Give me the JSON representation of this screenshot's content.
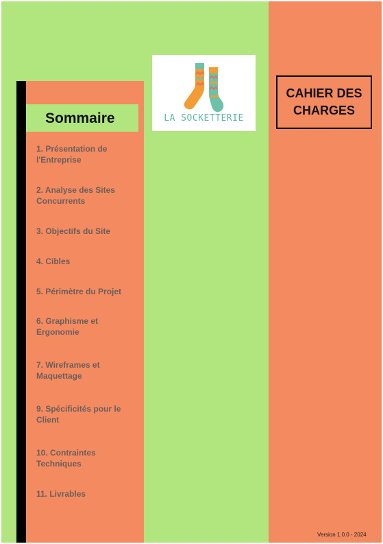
{
  "cover": {
    "title": "CAHIER DES CHARGES",
    "version": "Version 1.0.0 - 2024"
  },
  "logo": {
    "text": "LA SOCKETTERIE",
    "colors": {
      "sock_orange": "#f39c35",
      "sock_teal": "#6cc2a8",
      "zigzag": "#e86f5a",
      "text": "#5fb7a0"
    }
  },
  "toc": {
    "heading": "Sommaire",
    "items": [
      "1. Présentation de l'Entreprise",
      "2. Analyse des Sites Concurrents",
      "3. Objectifs du Site",
      "4. Cibles",
      "5. Périmètre du Projet",
      "6. Graphisme et Ergonomie",
      "7. Wireframes et Maquettage",
      "9. Spécificités pour le Client",
      "10. Contraintes Techniques",
      "11. Livrables"
    ]
  },
  "colors": {
    "green": "#b1e57d",
    "orange": "#f48a5f",
    "black": "#000000"
  }
}
